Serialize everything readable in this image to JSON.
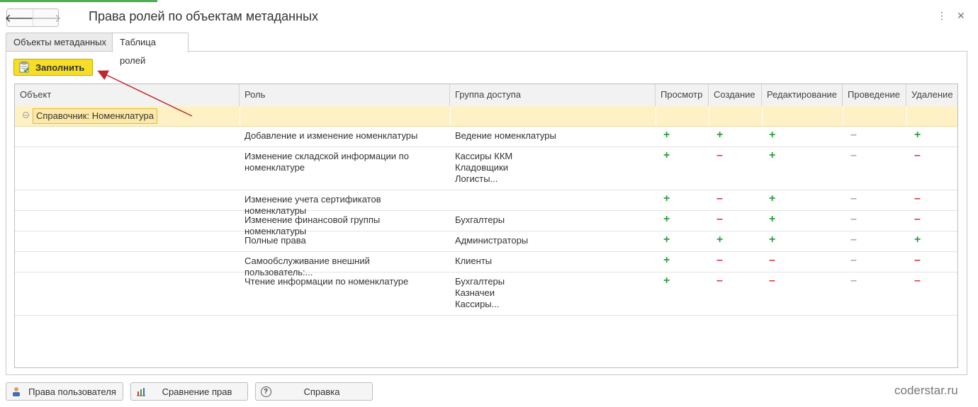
{
  "window": {
    "title": "Права ролей по объектам метаданных",
    "back_glyph": "🡐",
    "forward_glyph": "🡒",
    "menu_glyph": "⋮",
    "close_glyph": "✕"
  },
  "tabs": [
    {
      "label": "Объекты метаданных",
      "active": false
    },
    {
      "label": "Таблица ролей",
      "active": true
    }
  ],
  "toolbar": {
    "fill_label": "Заполнить",
    "fill_icon": "clipboard-icon"
  },
  "table": {
    "columns": [
      "Объект",
      "Роль",
      "Группа доступа",
      "Просмотр",
      "Создание",
      "Редактирование",
      "Проведение",
      "Удаление"
    ],
    "group": {
      "label": "Справочник: Номенклатура",
      "collapse_glyph": "⊖"
    },
    "rows": [
      {
        "role": "Добавление и изменение номенклатуры",
        "group": "Ведение номенклатуры",
        "perms": [
          "+",
          "+",
          "+",
          "–g",
          "+"
        ]
      },
      {
        "role": "Изменение складской информации по номенклатуре",
        "group": "Кассиры ККМ\nКладовщики\nЛогисты...",
        "perms": [
          "+",
          "–",
          "+",
          "–g",
          "–"
        ]
      },
      {
        "role": "Изменение учета сертификатов номенклатуры",
        "group": "",
        "perms": [
          "+",
          "–",
          "+",
          "–g",
          "–"
        ]
      },
      {
        "role": "Изменение финансовой группы номенклатуры",
        "group": "Бухгалтеры",
        "perms": [
          "+",
          "–",
          "+",
          "–g",
          "–"
        ]
      },
      {
        "role": "Полные права",
        "group": "Администраторы",
        "perms": [
          "+",
          "+",
          "+",
          "–g",
          "+"
        ]
      },
      {
        "role": "Самообслуживание внешний пользователь:...",
        "group": "Клиенты",
        "perms": [
          "+",
          "–",
          "–",
          "–g",
          "–"
        ]
      },
      {
        "role": "Чтение информации по номенклатуре",
        "group": "Бухгалтеры\nКазначеи\nКассиры...",
        "perms": [
          "+",
          "–",
          "–",
          "–g",
          "–"
        ]
      }
    ]
  },
  "footer": {
    "user_rights_label": "Права пользователя",
    "compare_label": "Сравнение прав",
    "help_label": "Справка",
    "help_glyph": "?"
  },
  "watermark": "coderstar.ru",
  "colors": {
    "plus": "#2e9e3e",
    "minus_red": "#e0303e",
    "minus_gray": "#aaaaaa",
    "accent_button": "#f6de26",
    "group_row": "#fdf1c5",
    "arrow": "#c0272d"
  }
}
